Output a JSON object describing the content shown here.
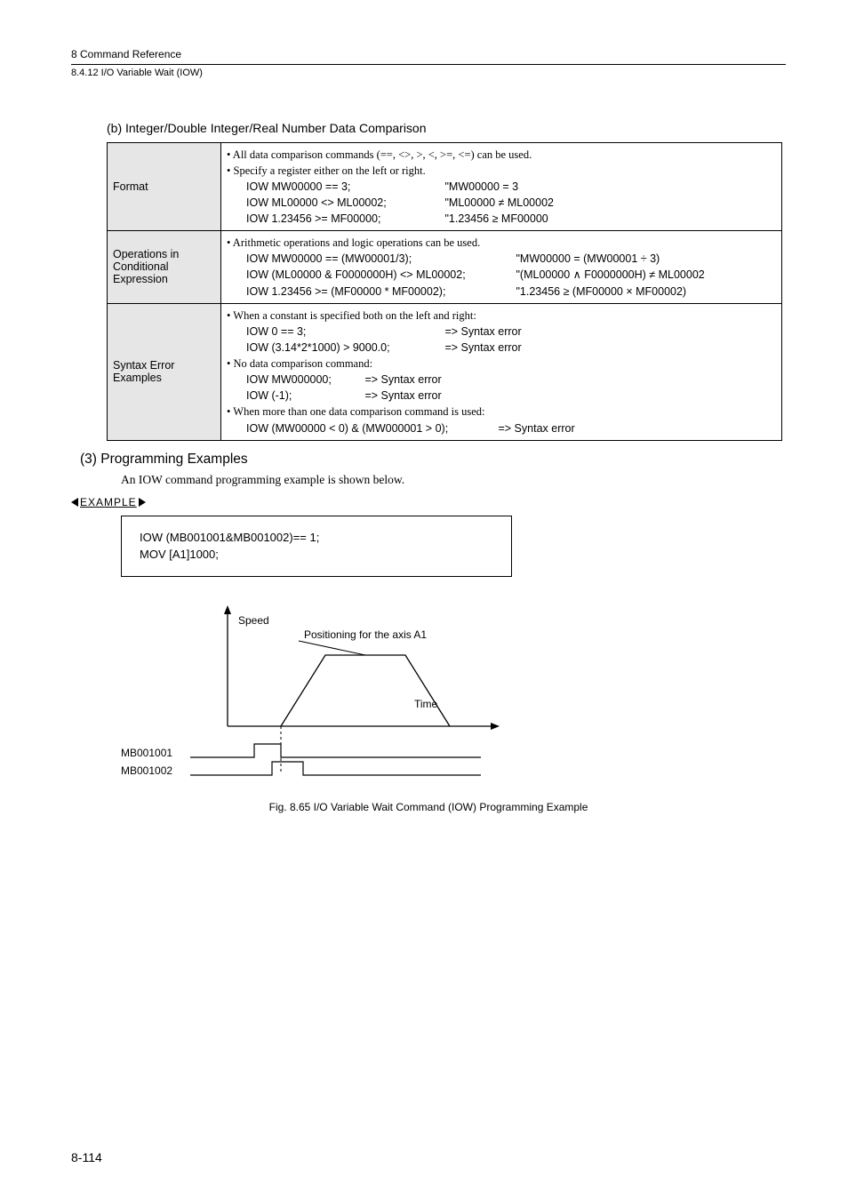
{
  "header": {
    "chapter": "8  Command Reference",
    "section": "8.4.12  I/O Variable Wait (IOW)"
  },
  "subheading_b": "(b) Integer/Double Integer/Real Number Data Comparison",
  "table": {
    "row1": {
      "label": "Format",
      "line1": "• All data comparison commands (==, <>, >, <, >=, <=) can be used.",
      "line2": "•  Specify a register either on the left or right.",
      "c1a": "IOW MW00000 == 3;",
      "c1b": "\"MW00000 = 3",
      "c2a": "IOW ML00000 <> ML00002;",
      "c2b": "\"ML00000 ≠ ML00002",
      "c3a": "IOW 1.23456 >= MF00000;",
      "c3b": "\"1.23456 ≥ MF00000"
    },
    "row2": {
      "label": "Operations in Conditional Expression",
      "line1": "• Arithmetic operations and logic operations can be used.",
      "c1a": "IOW MW00000 == (MW00001/3);",
      "c1b": "\"MW00000 = (MW00001 ÷ 3)",
      "c2a": "IOW (ML00000 & F0000000H) <> ML00002;",
      "c2b": "\"(ML00000 ∧ F0000000H) ≠ ML00002",
      "c3a": "IOW 1.23456 >= (MF00000 * MF00002);",
      "c3b": "\"1.23456 ≥ (MF00000 × MF00002)"
    },
    "row3": {
      "label": "Syntax Error Examples",
      "line1": "• When a constant is specified both on the left and right:",
      "c1a": "IOW 0 == 3;",
      "c1b": "=> Syntax error",
      "c2a": "IOW (3.14*2*1000) > 9000.0;",
      "c2b": "=> Syntax error",
      "line2": "•  No data comparison command:",
      "c3a": "IOW MW000000;",
      "c3b": "=> Syntax error",
      "c4a": "IOW (-1);",
      "c4b": "=> Syntax error",
      "line3": "• When more than one data comparison command is used:",
      "c5a": "IOW (MW00000 < 0) & (MW000001 > 0);",
      "c5b": "=> Syntax error"
    }
  },
  "section3": {
    "heading": "(3) Programming Examples",
    "body": "An IOW command programming example is shown below.",
    "example_label": "EXAMPLE"
  },
  "codebox": {
    "line1": "IOW (MB001001&MB001002)== 1;",
    "line2": "MOV [A1]1000;"
  },
  "diagram": {
    "speed": "Speed",
    "positioning": "Positioning for the axis A1",
    "time": "Time",
    "mb1": "MB001001",
    "mb2": "MB001002"
  },
  "figure_caption": "Fig. 8.65  I/O Variable Wait Command (IOW) Programming Example",
  "page_number": "8-114"
}
